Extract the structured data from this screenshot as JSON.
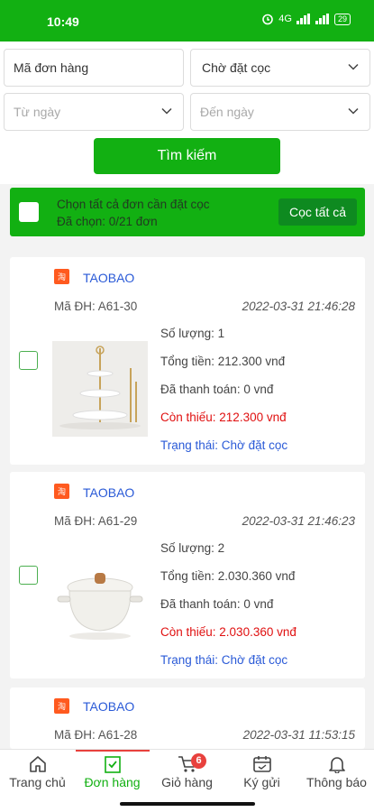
{
  "status_bar": {
    "time": "10:49",
    "network": "4G",
    "battery": "29"
  },
  "filters": {
    "order_code_placeholder": "Mã đơn hàng",
    "status_value": "Chờ đặt cọc",
    "from_date_placeholder": "Từ ngày",
    "to_date_placeholder": "Đến ngày",
    "search_label": "Tìm kiếm"
  },
  "select_all": {
    "line1": "Chọn tất cả đơn cần đặt cọc",
    "line2": "Đã chọn: 0/21 đơn",
    "deposit_all_label": "Cọc tất cả"
  },
  "orders": [
    {
      "shop_logo": "淘",
      "shop": "TAOBAO",
      "code": "Mã ĐH: A61-30",
      "date": "2022-03-31 21:46:28",
      "quantity": "Số lượng: 1",
      "total": "Tổng tiền: 212.300 vnđ",
      "paid": "Đã thanh toán: 0 vnđ",
      "remaining": "Còn thiếu: 212.300 vnđ",
      "status": "Trạng thái: Chờ đặt cọc",
      "image": "cake-stand-product-photo"
    },
    {
      "shop_logo": "淘",
      "shop": "TAOBAO",
      "code": "Mã ĐH: A61-29",
      "date": "2022-03-31 21:46:23",
      "quantity": "Số lượng: 2",
      "total": "Tổng tiền: 2.030.360 vnđ",
      "paid": "Đã thanh toán: 0 vnđ",
      "remaining": "Còn thiếu: 2.030.360 vnđ",
      "status": "Trạng thái: Chờ đặt cọc",
      "image": "cooking-pot-product-photo"
    },
    {
      "shop_logo": "淘",
      "shop": "TAOBAO",
      "code": "Mã ĐH: A61-28",
      "date": "2022-03-31 11:53:15"
    }
  ],
  "bottom_nav": {
    "home": "Trang chủ",
    "orders": "Đơn hàng",
    "cart": "Giỏ hàng",
    "cart_badge": "6",
    "consign": "Ký gửi",
    "notifications": "Thông báo"
  },
  "colors": {
    "brand_green": "#12b012",
    "alert_red": "#e01010",
    "link_blue": "#2a5ad7",
    "badge_red": "#e8413d"
  }
}
